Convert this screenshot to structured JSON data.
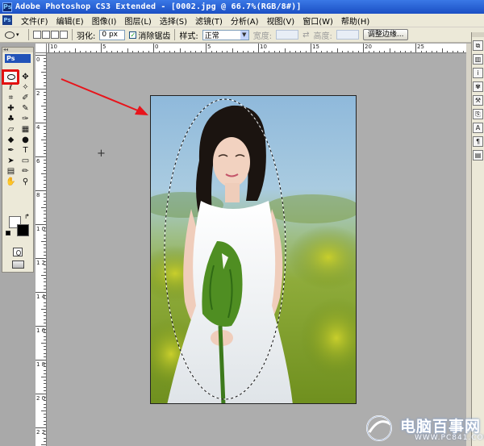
{
  "window": {
    "title": "Adobe Photoshop CS3 Extended - [0002.jpg @ 66.7%(RGB/8#)]",
    "app_icon": "Ps"
  },
  "menubar": {
    "items": [
      "文件(F)",
      "编辑(E)",
      "图像(I)",
      "图层(L)",
      "选择(S)",
      "滤镜(T)",
      "分析(A)",
      "视图(V)",
      "窗口(W)",
      "帮助(H)"
    ]
  },
  "options": {
    "feather_label": "羽化:",
    "feather_value": "0 px",
    "antialias_label": "消除锯齿",
    "antialias_checked": true,
    "style_label": "样式:",
    "style_value": "正常",
    "width_label": "宽度:",
    "height_label": "高度:",
    "refine_edge_button": "调整边缘..."
  },
  "toolbox": {
    "header": "Ps",
    "selected_tool": "elliptical-marquee",
    "foreground_color": "#ffffff",
    "background_color": "#000000"
  },
  "rulers": {
    "top_labels": [
      "10",
      "5",
      "0",
      "5",
      "10",
      "15",
      "20",
      "25",
      "30"
    ],
    "left_labels": [
      "0",
      "2",
      "4",
      "6",
      "8",
      "1 0",
      "1 2",
      "1 4",
      "1 6",
      "1 8",
      "2 0",
      "2 2"
    ]
  },
  "annotation": {
    "arrow_color": "#e8141b",
    "highlight_color": "#e21212"
  },
  "watermark": {
    "text": "电脑百事网",
    "url": "WWW.PC841.COM"
  }
}
